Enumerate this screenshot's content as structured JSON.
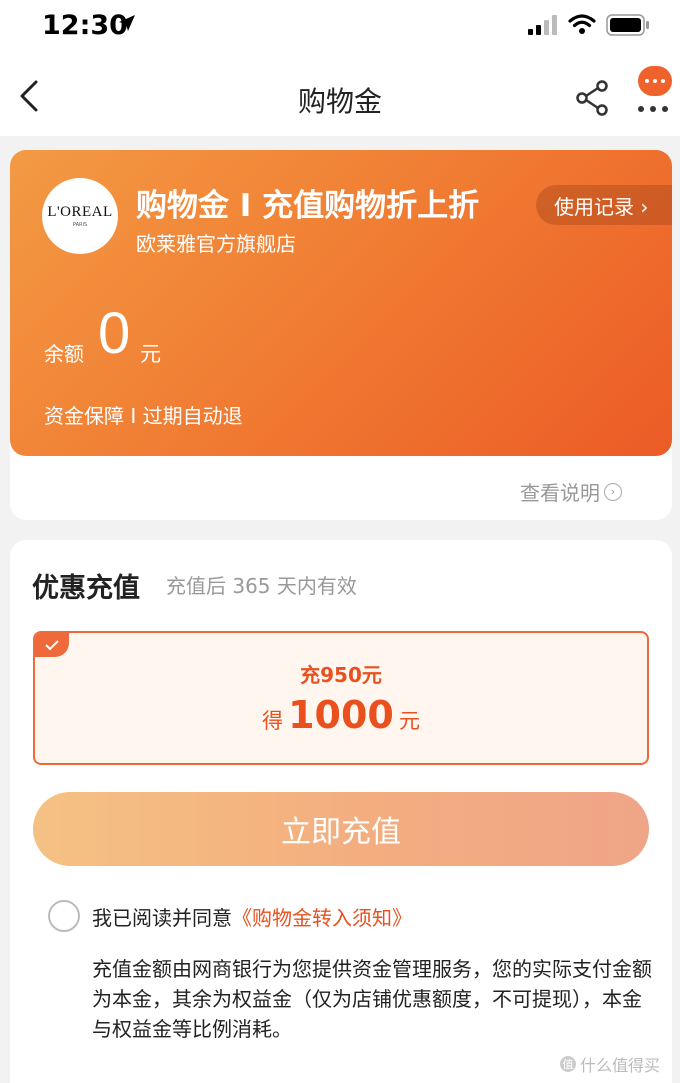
{
  "status_bar": {
    "time": "12:30"
  },
  "nav": {
    "title": "购物金"
  },
  "card": {
    "logo_main": "L'OREAL",
    "logo_sub": "PARIS",
    "title": "购物金 I 充值购物折上折",
    "store": "欧莱雅官方旗舰店",
    "records_button": "使用记录 ›",
    "balance_label": "余额",
    "balance_value": "0",
    "balance_unit": "元",
    "guarantee": "资金保障 I 过期自动退",
    "explain_link": "查看说明"
  },
  "recharge": {
    "title": "优惠充值",
    "validity": "充值后 365 天内有效",
    "option": {
      "pay_text": "充950元",
      "get_prefix": "得",
      "get_amount": "1000",
      "get_unit": "元",
      "selected": true
    },
    "button_label": "立即充值",
    "agree_text": "我已阅读并同意",
    "agree_link": "《购物金转入须知》",
    "notice": "充值金额由网商银行为您提供资金管理服务，您的实际支付金额为本金，其余为权益金（仅为店铺优惠额度，不可提现），本金与权益金等比例消耗。"
  },
  "watermark": {
    "text": "什么值得买"
  },
  "colors": {
    "accent": "#e9501e",
    "card_gradient_start": "#f39a44",
    "card_gradient_end": "#ec5b26",
    "button_gradient_start": "#f5c183",
    "button_gradient_end": "#efa588"
  },
  "icons": [
    "location-arrow-icon",
    "signal-icon",
    "wifi-icon",
    "battery-icon",
    "back-arrow-icon",
    "share-icon",
    "more-icon",
    "check-icon",
    "circle-chevron-icon"
  ]
}
